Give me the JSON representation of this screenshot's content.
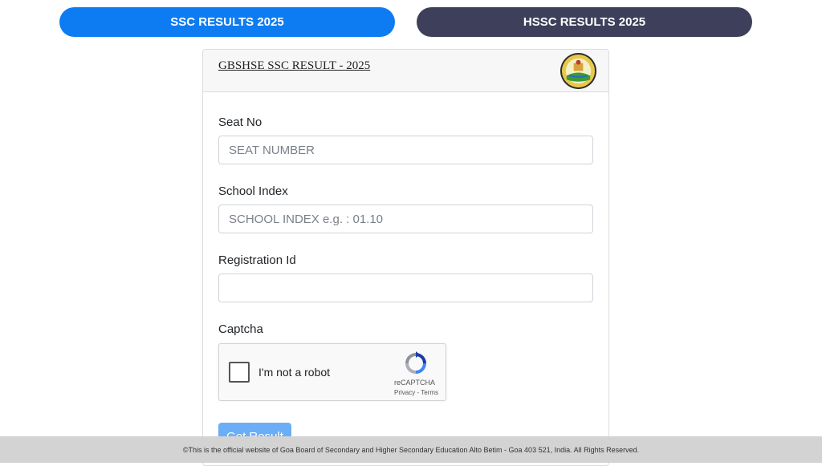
{
  "tabs": {
    "ssc_label": "SSC RESULTS 2025",
    "hssc_label": "HSSC RESULTS 2025",
    "ssc_color": "#0d7cf2",
    "hssc_color": "#3e3f5a"
  },
  "card": {
    "title": "GBSHSE SSC RESULT - 2025",
    "logo_icon": "board-emblem-icon"
  },
  "form": {
    "seat_no": {
      "label": "Seat No",
      "placeholder": "SEAT NUMBER",
      "value": ""
    },
    "school_index": {
      "label": "School Index",
      "placeholder": "SCHOOL INDEX e.g. : 01.10",
      "value": ""
    },
    "registration_id": {
      "label": "Registration Id",
      "placeholder": "",
      "value": ""
    },
    "captcha": {
      "label": "Captcha",
      "checkbox_text": "I'm not a robot",
      "brand": "reCAPTCHA",
      "privacy": "Privacy",
      "separator": " - ",
      "terms": "Terms"
    },
    "submit_label": "Get Result"
  },
  "footer": {
    "text": "©This is the official website of Goa Board of Secondary and Higher Secondary Education Alto Betim - Goa 403 521, India. All Rights Reserved."
  }
}
